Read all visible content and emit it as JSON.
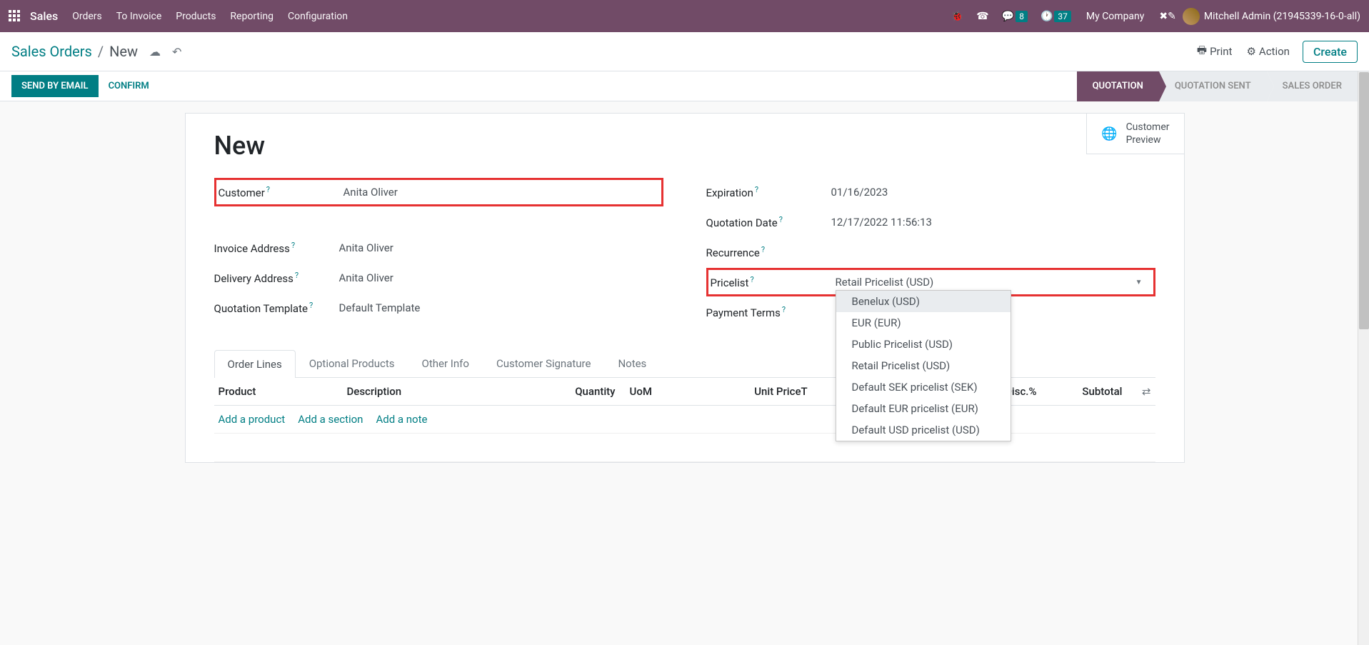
{
  "topnav": {
    "brand": "Sales",
    "links": [
      "Orders",
      "To Invoice",
      "Products",
      "Reporting",
      "Configuration"
    ],
    "chat_badge": "8",
    "clock_badge": "37",
    "company": "My Company",
    "user": "Mitchell Admin (21945339-16-0-all)"
  },
  "breadcrumb": {
    "parent": "Sales Orders",
    "current": "New",
    "print": "Print",
    "action": "Action",
    "create": "Create"
  },
  "actionbar": {
    "send_email": "SEND BY EMAIL",
    "confirm": "CONFIRM",
    "status": [
      "QUOTATION",
      "QUOTATION SENT",
      "SALES ORDER"
    ]
  },
  "form": {
    "title": "New",
    "customer_preview_l1": "Customer",
    "customer_preview_l2": "Preview",
    "left": {
      "customer": {
        "label": "Customer",
        "value": "Anita Oliver"
      },
      "invoice_address": {
        "label": "Invoice Address",
        "value": "Anita Oliver"
      },
      "delivery_address": {
        "label": "Delivery Address",
        "value": "Anita Oliver"
      },
      "quotation_template": {
        "label": "Quotation Template",
        "value": "Default Template"
      }
    },
    "right": {
      "expiration": {
        "label": "Expiration",
        "value": "01/16/2023"
      },
      "quotation_date": {
        "label": "Quotation Date",
        "value": "12/17/2022 11:56:13"
      },
      "recurrence": {
        "label": "Recurrence",
        "value": ""
      },
      "pricelist": {
        "label": "Pricelist",
        "value": "Retail Pricelist (USD)"
      },
      "payment_terms": {
        "label": "Payment Terms",
        "value": ""
      }
    },
    "pricelist_options": [
      "Benelux (USD)",
      "EUR (EUR)",
      "Public Pricelist (USD)",
      "Retail Pricelist (USD)",
      "Default SEK pricelist (SEK)",
      "Default EUR pricelist (EUR)",
      "Default USD pricelist (USD)"
    ]
  },
  "tabs": [
    "Order Lines",
    "Optional Products",
    "Other Info",
    "Customer Signature",
    "Notes"
  ],
  "table": {
    "headers": {
      "product": "Product",
      "description": "Description",
      "quantity": "Quantity",
      "uom": "UoM",
      "unit_price": "Unit Price",
      "t": "T",
      "disc": "Disc.%",
      "subtotal": "Subtotal"
    },
    "actions": {
      "add_product": "Add a product",
      "add_section": "Add a section",
      "add_note": "Add a note"
    }
  }
}
